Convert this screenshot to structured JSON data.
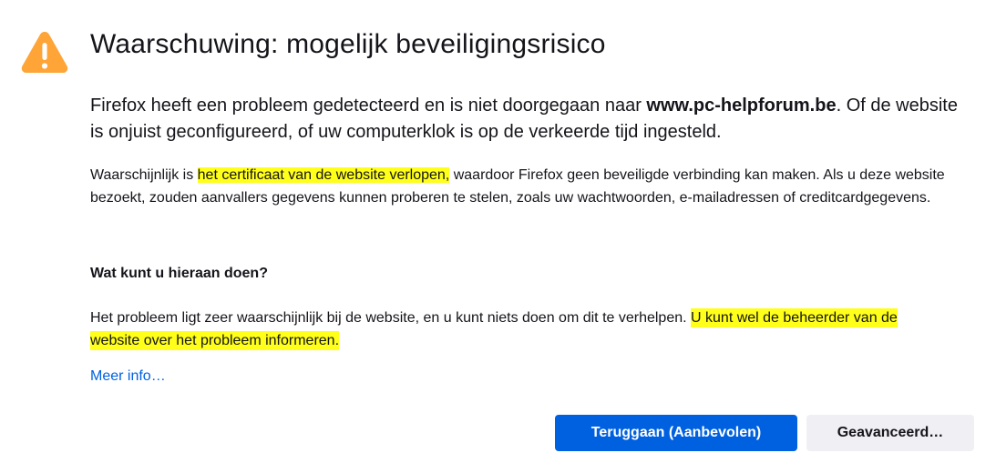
{
  "icon": "warning-triangle-icon",
  "colors": {
    "warning": "#ffa436",
    "highlight": "#ffff1a",
    "link": "#0061e0",
    "primary_button": "#0061e0",
    "secondary_button": "#f0f0f4"
  },
  "title": "Waarschuwing: mogelijk beveiligingsrisico",
  "intro": {
    "before": "Firefox heeft een probleem gedetecteerd en is niet doorgegaan naar ",
    "domain": "www.pc-helpforum.be",
    "after": ". Of de website is onjuist geconfigureerd, of uw computerklok is op de verkeerde tijd ingesteld."
  },
  "detail": {
    "before": "Waarschijnlijk is ",
    "highlight": "het certificaat van de website verlopen,",
    "after": " waardoor Firefox geen beveiligde verbinding kan maken. Als u deze website bezoekt, zouden aanvallers gegevens kunnen proberen te stelen, zoals uw wachtwoorden, e-mailadressen of creditcardgegevens."
  },
  "what_to_do": {
    "heading": "Wat kunt u hieraan doen?",
    "before": "Het probleem ligt zeer waarschijnlijk bij de website, en u kunt niets doen om dit te verhelpen. ",
    "highlight": "U kunt wel de beheerder van de website over het probleem informeren."
  },
  "more_info_link": "Meer info…",
  "buttons": {
    "go_back": "Teruggaan (Aanbevolen)",
    "advanced": "Geavanceerd…"
  }
}
